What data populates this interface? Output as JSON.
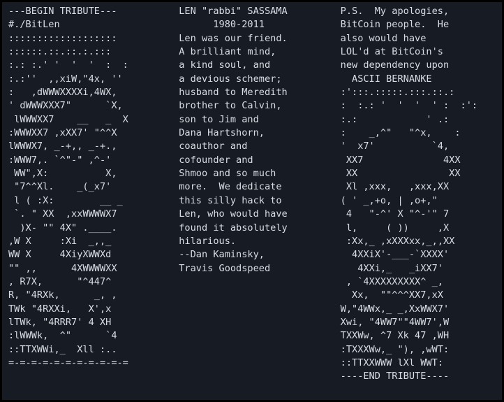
{
  "terminal": {
    "background_color": "#171c24",
    "text_color": "#d9dde4",
    "border_color": "#000000"
  },
  "columns": {
    "left": {
      "name": "bitlen-ascii-art",
      "text": "---BEGIN TRIBUTE---\n#./BitLen\n:::::::::::::::::::\n::::::.::.::.:.:::\n:.: :.' '  '  '  :  :\n:.:''  ,,xiW,\"4x, ''\n:   ,dWWWXXXXi,4WX,\n' dWWWXXX7\"      `X,\n lWWWXX7    __   _  X\n:WWWXX7 ,xXX7' \"^^X\nlWWWX7, _-+,, _-+.,\n:WWW7,. `^\"-\" ,^-'\n WW\",X:          X,\n \"7^^Xl.    _(_x7'\n l ( :X:        __ _\n `. \" XX  ,xxWWWWX7\n  )X- \"\" 4X\" .____.\n,W X     :Xi  _,,_\nWW X     4XiyXWWXd\n\"\" ,,      4XWWWWXX\n, R7X,      \"^447^\nR, \"4RXk,      _, ,\nTWk \"4RXXi,   X',x\nlTWk, \"4RRR7' 4 XH\n:lWWWk,  ^\"      `4\n::TTXWWi,_  Xll :..\n=-=-=-=-=-=-=-=-=-=-="
    },
    "middle": {
      "name": "tribute-text",
      "text": "LEN \"rabbi\" SASSAMA\n      1980-2011\nLen was our friend.\nA brilliant mind,\na kind soul, and\na devious schemer;\nhusband to Meredith\nbrother to Calvin,\nson to Jim and\nDana Hartshorn,\ncoauthor and\ncofounder and\nShmoo and so much\nmore.  We dedicate\nthis silly hack to\nLen, who would have\nfound it absolutely\nhilarious.\n--Dan Kaminsky,\nTravis Goodspeed"
    },
    "right": {
      "name": "bernanke-ascii-art",
      "text": "P.S.  My apologies,\nBitCoin people.  He\nalso would have\nLOL'd at BitCoin's\nnew dependency upon\n  ASCII BERNANKE\n:':::.:::::.:::.::.:\n:  :.: '  '  '  ' :  :':\n:.:            ' .:\n:    _,^\"   \"^x,    :\n'  x7'          `4,\n XX7              4XX\n XX                XX\n Xl ,xxx,   ,xxx,XX\n( ' _,+o, | ,o+,\"\n 4   \"-^' X \"^-'\" 7\n l,     ( ))     ,X\n :Xx,_ ,xXXXxx,_,,XX\n  4XXiX'-___-`XXXX'\n   4XXi,_   _iXX7'\n , `4XXXXXXXXX^ _,\n  Xx,  \"\"^^^XX7,xX\nW,\"4WWx,_ _,XxWWX7'\nXwi, \"4WW7\"\"4WW7',W\nTXXWw, ^7 Xk 47 ,WH\n:TXXXWw,_ \"), ,wWT:\n::TTXXWWW lXl WWT:\n----END TRIBUTE----"
    }
  }
}
